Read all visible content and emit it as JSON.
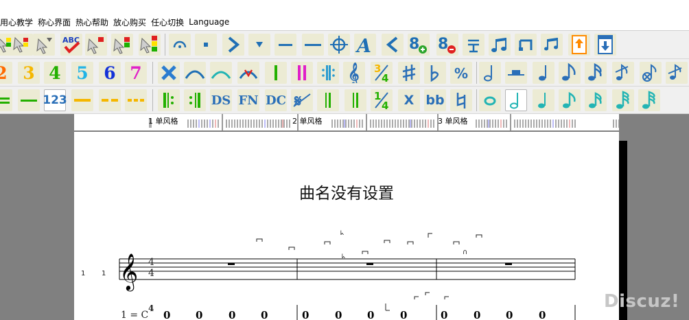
{
  "menu": [
    "用心教学",
    "称心界面",
    "热心帮助",
    "放心购买",
    "任心切换",
    "Language"
  ],
  "toolbar2": {
    "digits": [
      "2",
      "3",
      "4",
      "5",
      "6",
      "7"
    ]
  },
  "toolbar3": {
    "numbered_label": "123",
    "ds_label": "DS",
    "fn_label": "FN",
    "dc_label": "DC",
    "x_label": "X",
    "bb_label": "bb"
  },
  "colors": {
    "accent": "#38b4c6",
    "digit_colors": [
      "#ff6a00",
      "#f5b700",
      "#23b000",
      "#22b4e6",
      "#1432d8",
      "#e020c8"
    ]
  },
  "ruler": {
    "labels": [
      "1 单风格",
      "2 单风格",
      "3 单风格"
    ]
  },
  "score": {
    "title": "曲名没有设置",
    "row1_labels": [
      "1",
      "1"
    ],
    "time_signature": {
      "top": "4",
      "bottom": "4"
    },
    "key_text": "1 = C",
    "row2_notes": [
      "0",
      "0",
      "0",
      "0",
      "0",
      "0",
      "0",
      "0",
      "0",
      "0",
      "0",
      "0"
    ]
  },
  "watermark": "Discuz!"
}
